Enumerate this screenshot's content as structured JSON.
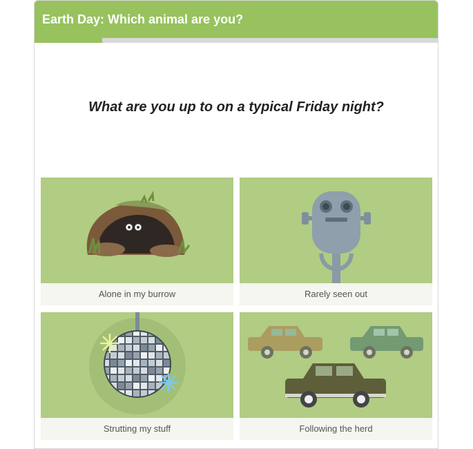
{
  "quiz": {
    "title": "Earth Day: Which animal are you?",
    "progress": 0.167,
    "question": "What are you up to on a typical Friday night?",
    "options": [
      {
        "label": "Alone in my burrow"
      },
      {
        "label": "Rarely seen out"
      },
      {
        "label": "Strutting my stuff"
      },
      {
        "label": "Following the herd"
      }
    ]
  },
  "colors": {
    "accent": "#97c25e",
    "tile_bg": "#b1cc83",
    "label_bg": "#f4f6ef",
    "progress_track": "#d9d9d9"
  },
  "icons": [
    "burrow-illustration",
    "viewer-binoculars-illustration",
    "disco-ball-illustration",
    "cars-herd-illustration"
  ]
}
